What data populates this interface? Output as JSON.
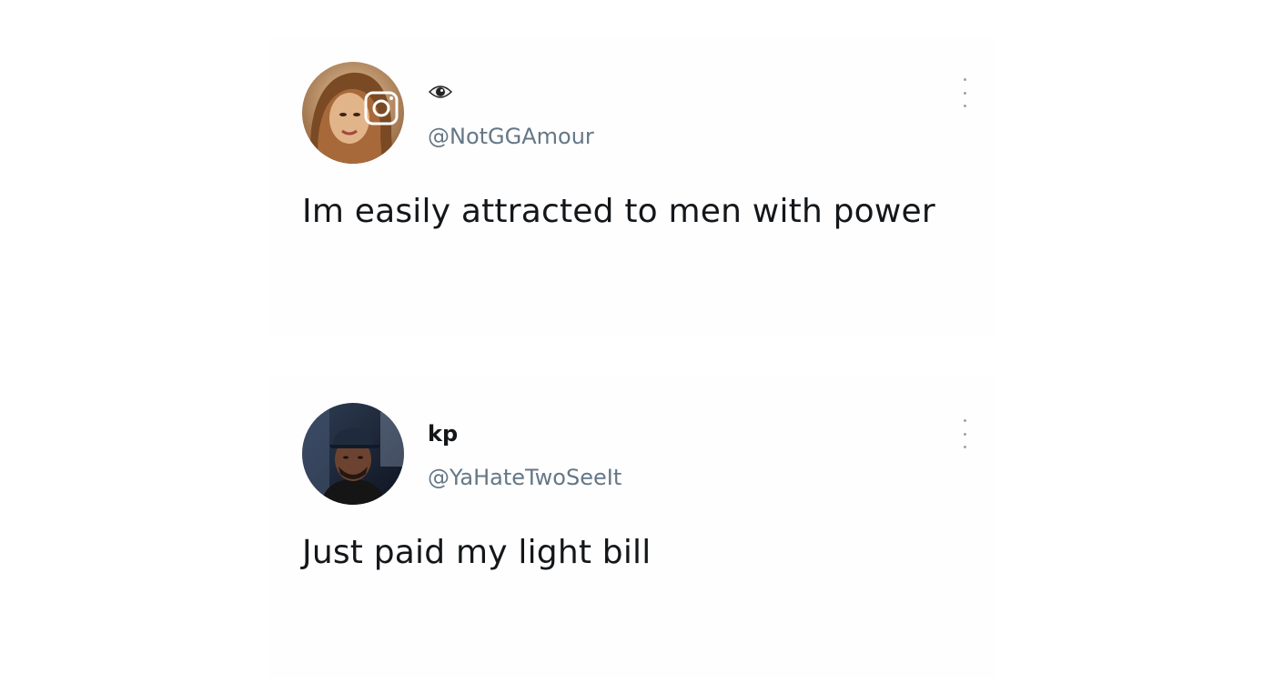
{
  "tweets": [
    {
      "display_name": "👁",
      "display_name_icon": "eye-icon",
      "handle": "@NotGGAmour",
      "text": "Im easily attracted to men with power",
      "avatar": "woman-portrait-avatar"
    },
    {
      "display_name": "kp",
      "handle": "@YaHateTwoSeeIt",
      "text": "Just paid my light bill",
      "avatar": "man-portrait-avatar"
    }
  ],
  "colors": {
    "text": "#14171a",
    "handle": "#657786",
    "background": "#ffffff"
  }
}
